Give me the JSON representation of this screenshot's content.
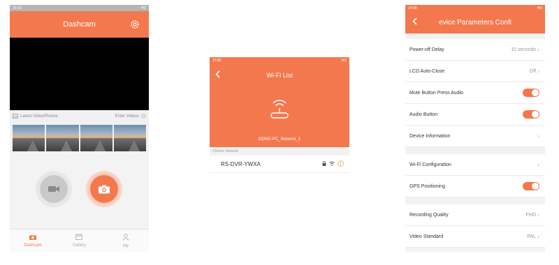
{
  "colors": {
    "accent": "#f4784e",
    "dark": "#000000"
  },
  "phone1": {
    "status_time": "15:00",
    "status_right": "HD",
    "title": "Dashcam",
    "latest_label": "Latest Video/Picture",
    "enter_videos": "Enter Videos",
    "thumbnail_count": 4,
    "tabs": [
      {
        "label": "Dashcam",
        "icon": "camera-icon"
      },
      {
        "label": "Gallery",
        "icon": "calendar-icon"
      },
      {
        "label": "My",
        "icon": "user-icon"
      }
    ]
  },
  "phone2": {
    "status_time": "15:02",
    "status_right": "HD",
    "title": "Wi-Fi List",
    "network_name": "GDNG-PC_Network_1",
    "choose_label": "Choose Network",
    "network_row": "RS-DVR-YWXA"
  },
  "phone3": {
    "status_time": "14:59",
    "status_right": "HD",
    "title": "evice Parameters Confi",
    "rows": [
      {
        "label": "Power-off Delay",
        "value": "10 seconds"
      },
      {
        "label": "LCD Auto-Close",
        "value": "Off"
      },
      {
        "label": "Mute Button Press Audio"
      },
      {
        "label": "Audio Button"
      },
      {
        "label": "Device Information"
      },
      {
        "label": "Wi-Fi Configuration"
      },
      {
        "label": "GPS Positioning"
      },
      {
        "label": "Recording Quality",
        "value": "FHD"
      },
      {
        "label": "Video Standard",
        "value": "PAL"
      }
    ]
  }
}
